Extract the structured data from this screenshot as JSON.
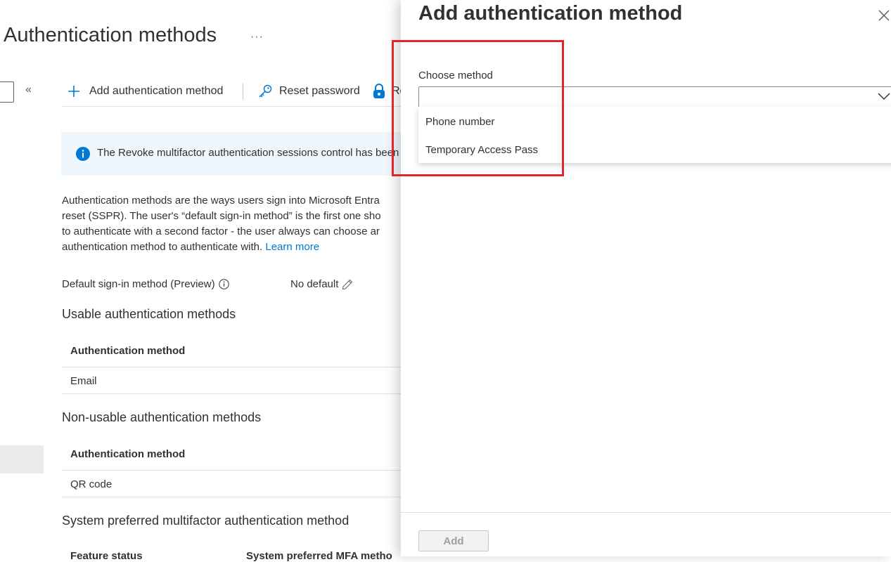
{
  "page": {
    "title": "Authentication methods",
    "more": "···",
    "collapse": "«"
  },
  "toolbar": {
    "add_label": "Add authentication method",
    "reset_label": "Reset password",
    "revoke_label": "Re"
  },
  "info": {
    "text": "The Revoke multifactor authentication sessions control has been u"
  },
  "description": {
    "line1": "Authentication methods are the ways users sign into Microsoft Entra",
    "line2": "reset (SSPR). The user's “default sign-in method” is the first one sho",
    "line3": "to authenticate with a second factor - the user always can choose ar",
    "line4": "authentication method to authenticate with.",
    "learn_more": "Learn more"
  },
  "default_sign_in": {
    "label": "Default sign-in method (Preview)",
    "value": "No default"
  },
  "usable": {
    "heading": "Usable authentication methods",
    "column": "Authentication method",
    "rows": [
      "Email"
    ]
  },
  "non_usable": {
    "heading": "Non-usable authentication methods",
    "column": "Authentication method",
    "rows": [
      "QR code"
    ]
  },
  "system_preferred": {
    "heading": "System preferred multifactor authentication method",
    "col1": "Feature status",
    "col2": "System preferred MFA metho"
  },
  "panel": {
    "title": "Add authentication method",
    "choose_label": "Choose method",
    "dropdown_value": "",
    "options": [
      "Phone number",
      "Temporary Access Pass"
    ],
    "add_button": "Add"
  },
  "colors": {
    "accent": "#0078d4",
    "highlight": "#e3262b",
    "info_background": "#eff6fc"
  }
}
